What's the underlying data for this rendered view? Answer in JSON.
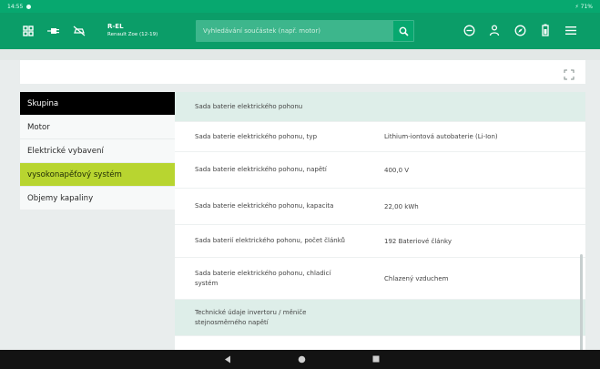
{
  "status_bar": {
    "time": "14:55",
    "right_indicators": "⚡ 71%"
  },
  "header": {
    "vehicle_code": "R-EL",
    "vehicle_model": "Renault Zoe (12-19)",
    "search_placeholder": "Vyhledávání součástek (např. motor)",
    "icons_left": [
      "grid-icon",
      "plug-icon",
      "car-off-icon"
    ],
    "icons_right": [
      "minus-circle-icon",
      "person-icon",
      "compass-icon",
      "battery-icon",
      "menu-icon"
    ]
  },
  "sidebar": {
    "items": [
      {
        "label": "Skupina"
      },
      {
        "label": "Motor"
      },
      {
        "label": "Elektrické vybavení"
      },
      {
        "label": "vysokonapěťový systém"
      },
      {
        "label": "Objemy kapaliny"
      }
    ]
  },
  "table": {
    "section_1": "Sada baterie elektrického pohonu",
    "rows": [
      {
        "label": "Sada baterie elektrického pohonu, typ",
        "value": "Lithium-iontová autobaterie (Li-Ion)"
      },
      {
        "label": "Sada baterie elektrického pohonu, napětí",
        "value": "400,0 V"
      },
      {
        "label": "Sada baterie elektrického pohonu, kapacita",
        "value": "22,00 kWh"
      },
      {
        "label": "Sada baterií elektrického pohonu, počet článků",
        "value": "192 Bateriové články"
      },
      {
        "label": "Sada baterie elektrického pohonu, chladicí systém",
        "value": "Chlazený vzduchem"
      }
    ],
    "section_2": "Technické údaje invertoru / měniče stejnosměrného napětí"
  },
  "colors": {
    "brand_green": "#0b9d68",
    "active_lime": "#b8d530"
  }
}
